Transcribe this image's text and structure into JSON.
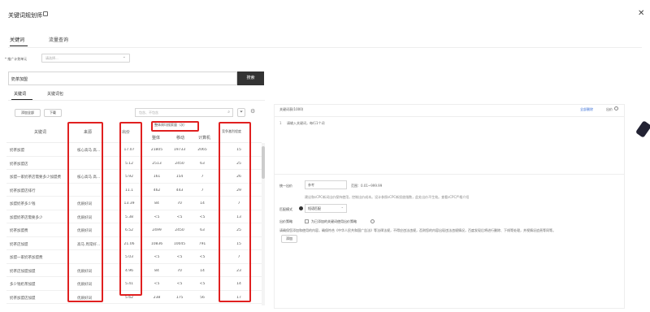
{
  "dialog": {
    "title": "关键词规划师",
    "tabs": [
      "关键词",
      "流量查询"
    ]
  },
  "form": {
    "plan_label": "* 推广计划单元",
    "plan_placeholder": "请选择...",
    "keyword_input_value": "奶茶加盟",
    "search_label": "搜索"
  },
  "left": {
    "subtabs": [
      "关键词",
      "关键词包"
    ],
    "add_all_label": "添加全部",
    "download_label": "下载",
    "filter_placeholder": "包含、不包含",
    "columns": {
      "keyword": "关键词",
      "source": "来源",
      "bid": "出价",
      "monthly_group": "整体周均搜索量（次）",
      "overall": "整体",
      "mobile": "移动",
      "pc": "计算机",
      "competition": "竞争激烈程度"
    },
    "rows": [
      {
        "kw": "奶茶加盟",
        "src": "核心高马 高…",
        "bid": "17.07",
        "all": "21805",
        "mob": "19733",
        "pc": "2065",
        "comp": "15"
      },
      {
        "kw": "奶茶加盟店",
        "src": "",
        "bid": "5.12",
        "all": "2513",
        "mob": "2450",
        "pc": "63",
        "comp": "25"
      },
      {
        "kw": "加盟一家奶茶店需要多少加盟费",
        "src": "核心高马 高…",
        "bid": "5.92",
        "all": "161",
        "mob": "154",
        "pc": "7",
        "comp": "26"
      },
      {
        "kw": "奶茶加盟店排行",
        "src": "",
        "bid": "11.1",
        "all": "462",
        "mob": "443",
        "pc": "7",
        "comp": "29"
      },
      {
        "kw": "加盟奶茶多少钱",
        "src": "优质好词",
        "bid": "13.39",
        "all": "84",
        "mob": "70",
        "pc": "14",
        "comp": "7"
      },
      {
        "kw": "加盟奶茶店需要多少",
        "src": "优质好词",
        "bid": "5.38",
        "all": "<5",
        "mob": "<5",
        "pc": "<5",
        "comp": "13"
      },
      {
        "kw": "奶茶加盟费",
        "src": "优质好词",
        "bid": "6.52",
        "all": "2499",
        "mob": "2450",
        "pc": "63",
        "comp": "25"
      },
      {
        "kw": "奶茶店加盟",
        "src": "高马 周常好…",
        "bid": "21.06",
        "all": "10836",
        "mob": "10045",
        "pc": "791",
        "comp": "15"
      },
      {
        "kw": "加盟一家奶茶加盟费",
        "src": "",
        "bid": "5.03",
        "all": "<5",
        "mob": "<5",
        "pc": "<5",
        "comp": "7"
      },
      {
        "kw": "奶茶店加盟加盟",
        "src": "优质好词",
        "bid": "4.96",
        "all": "84",
        "mob": "70",
        "pc": "14",
        "comp": "23"
      },
      {
        "kw": "多少钱奶茶加盟",
        "src": "优质好词",
        "bid": "5.41",
        "all": "<5",
        "mob": "<5",
        "pc": "<5",
        "comp": "14"
      },
      {
        "kw": "奶茶加盟店加盟",
        "src": "优质好词",
        "bid": "5.62",
        "all": "238",
        "mob": "175",
        "pc": "56",
        "comp": "17"
      }
    ]
  },
  "right": {
    "header": "关键词表(1000)",
    "delete_all": "全部删除",
    "bid_header": "出价",
    "textarea_placeholder": "请输入关键词，每行1个词",
    "bid_label": "统一出价",
    "bid_value": "参考",
    "bid_range": "范围：0.01~999.99",
    "bid_hint": "建议和sCPC新词出价保持使用，控制出价成本。设计参照sCPC新投放指数，此处出价不生效。查看sCPC严格介绍",
    "match_label": "匹配模式",
    "match_value": "短语匹配",
    "strategy_label": "出价策略",
    "strategy_option": "为已添加的关键词使用出价策略",
    "disclaimer": "请确保您添加和使用的内容，确保符合《中华人民共和国广告法》等法律法规，不得应违法违规，否则您的内容出现违法违规情况，百度发现后将进行删除、下线等处理，并视情况追责等同等。",
    "add_label": "添加"
  },
  "colors": {
    "highlight_red": "#e02020",
    "dark_button": "#333333",
    "link_blue": "#3b6fd6"
  }
}
